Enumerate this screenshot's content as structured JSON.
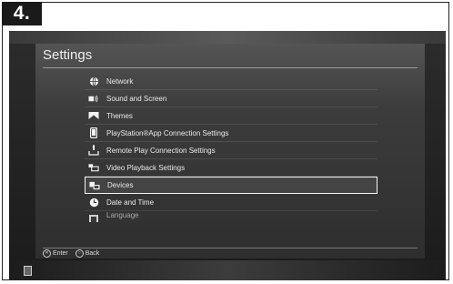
{
  "badge": {
    "step": "4."
  },
  "screen": {
    "title": "Settings",
    "menu": [
      {
        "label": "Network",
        "icon": "globe-icon"
      },
      {
        "label": "Sound and Screen",
        "icon": "speaker-screen-icon"
      },
      {
        "label": "Themes",
        "icon": "themes-icon"
      },
      {
        "label": "PlayStation®App Connection Settings",
        "icon": "phone-icon"
      },
      {
        "label": "Remote Play Connection Settings",
        "icon": "remote-play-icon"
      },
      {
        "label": "Video Playback Settings",
        "icon": "video-playback-icon"
      },
      {
        "label": "Devices",
        "icon": "devices-icon",
        "selected": true
      },
      {
        "label": "Date and Time",
        "icon": "clock-icon"
      },
      {
        "label": "Language",
        "icon": "language-icon"
      }
    ],
    "footer": {
      "enter_glyph": "✕",
      "enter_label": "Enter",
      "back_glyph": "○",
      "back_label": "Back"
    }
  },
  "colors": {
    "selection_border": "#f4f4f4",
    "screen_bg": "#3c3c3c",
    "text": "#eaeaea"
  }
}
